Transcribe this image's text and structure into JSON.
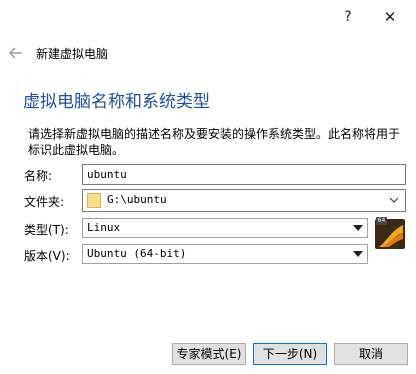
{
  "titlebar": {
    "help_glyph": "?",
    "close_glyph": "✕"
  },
  "header": {
    "wizard_title": "新建虚拟电脑"
  },
  "page": {
    "title": "虚拟电脑名称和系统类型",
    "description": "请选择新虚拟电脑的描述名称及要安装的操作系统类型。此名称将用于标识此虚拟电脑。"
  },
  "form": {
    "name_label": "名称:",
    "name_value": "ubuntu",
    "folder_label": "文件夹:",
    "folder_value": "G:\\ubuntu",
    "type_label": "类型(T):",
    "type_value": "Linux",
    "version_label": "版本(V):",
    "version_value": "Ubuntu (64-bit)",
    "os_icon_badge": "64"
  },
  "buttons": {
    "expert": "专家模式(E)",
    "next": "下一步(N)",
    "cancel": "取消"
  },
  "colors": {
    "accent": "#1d50a3",
    "focus_border": "#0078d7"
  }
}
